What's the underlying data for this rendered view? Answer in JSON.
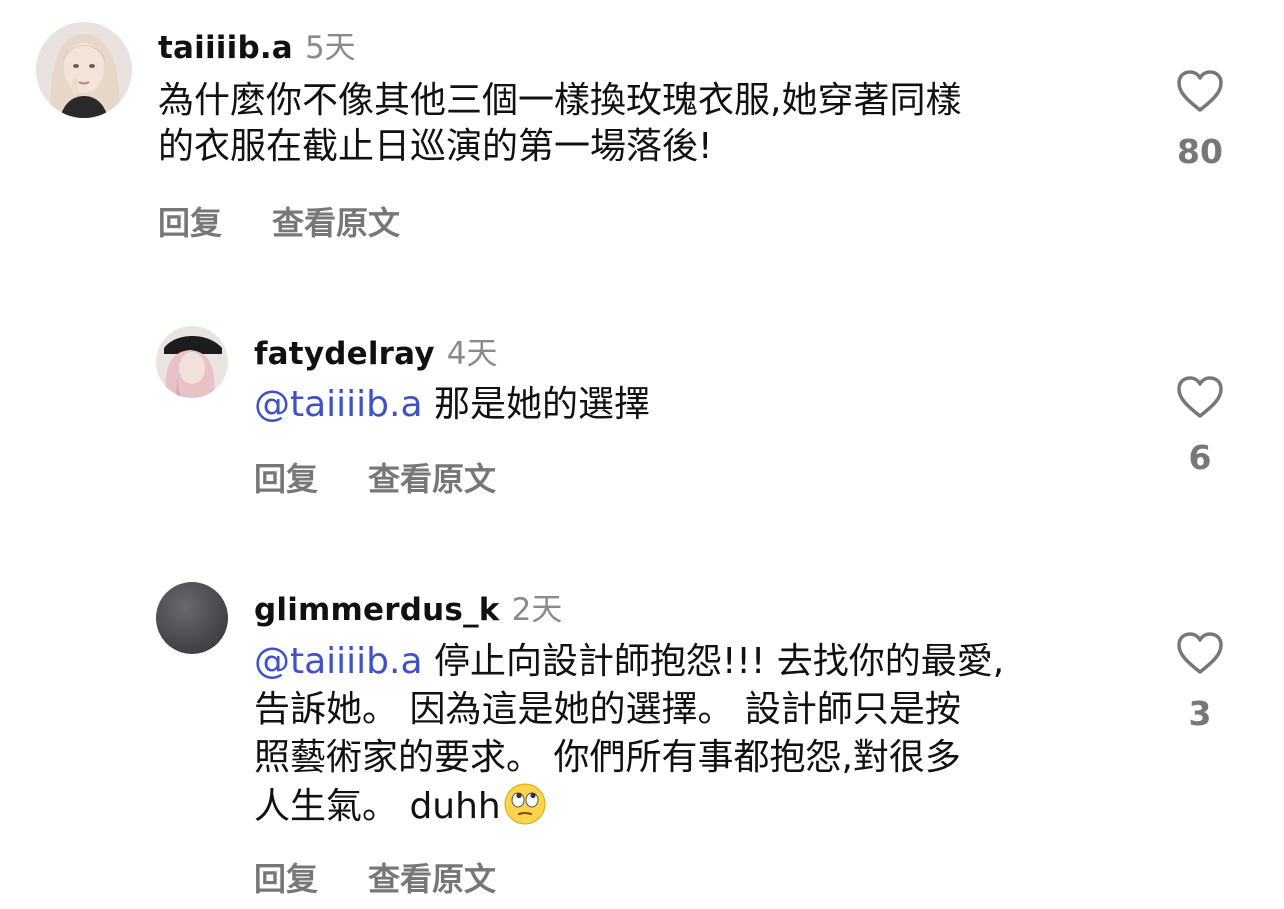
{
  "comments": [
    {
      "username": "taiiiib.a",
      "time": "5天",
      "lines": [
        "為什麼你不像其他三個一樣換玫瑰衣服,她穿著同樣",
        "的衣服在截止日巡演的第一場落後!"
      ],
      "reply_label": "回复",
      "translate_label": "查看原文",
      "likes": "80"
    },
    {
      "username": "fatydelray",
      "time": "4天",
      "mention": "@taiiiib.a",
      "lines": [
        " 那是她的選擇"
      ],
      "reply_label": "回复",
      "translate_label": "查看原文",
      "likes": "6"
    },
    {
      "username": "glimmerdus_k",
      "time": "2天",
      "mention": "@taiiiib.a",
      "lines": [
        " 停止向設計師抱怨!!! 去找你的最愛,",
        "告訴她。 因為這是她的選擇。 設計師只是按",
        "照藝術家的要求。 你們所有事都抱怨,對很多",
        "人生氣。 duhh"
      ],
      "emoji": "eye-roll-emoji",
      "reply_label": "回复",
      "translate_label": "查看原文",
      "likes": "3"
    }
  ],
  "colors": {
    "mention": "#3f51c9",
    "muted": "#8a8a8a",
    "action": "#777777"
  },
  "icons": [
    "heart-outline-icon",
    "avatar",
    "eye-roll-emoji"
  ]
}
